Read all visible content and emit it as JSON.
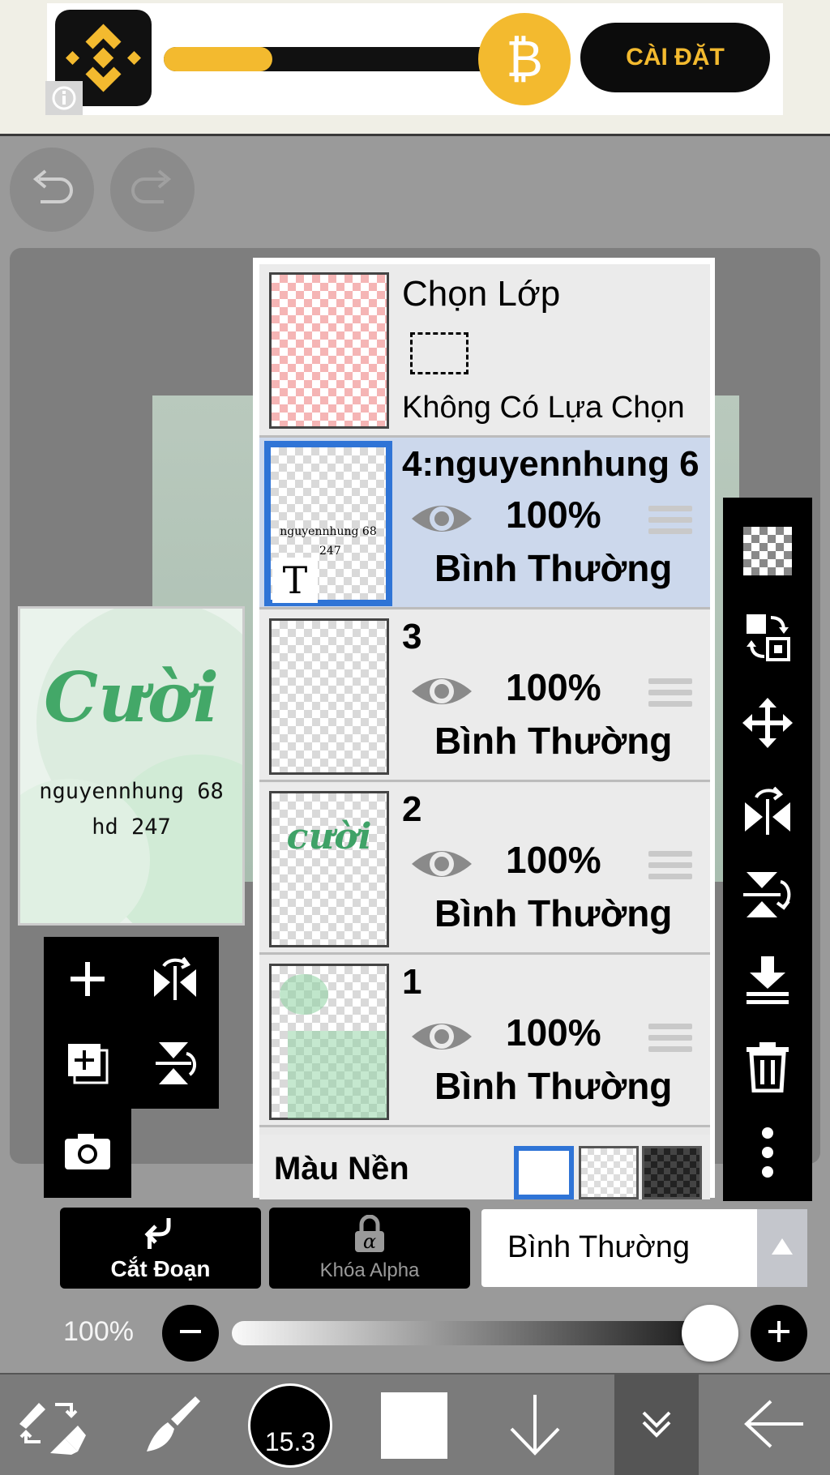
{
  "ad": {
    "cta_label": "CÀI ĐẶT",
    "progress": 0.32,
    "brand_color": "#f3ba2f"
  },
  "preview": {
    "title_art": "Cười",
    "line1": "nguyennhung 68",
    "line2": "hd 247"
  },
  "layers_panel": {
    "selection": {
      "title": "Chọn Lớp",
      "status": "Không Có Lựa Chọn"
    },
    "layers": [
      {
        "name": "4:nguyennhung 6",
        "opacity": "100%",
        "blend": "Bình Thường",
        "active": true,
        "thumb_text1": "nguyennhung 68",
        "thumb_text2": "247",
        "thumb_badge": "T"
      },
      {
        "name": "3",
        "opacity": "100%",
        "blend": "Bình Thường",
        "active": false
      },
      {
        "name": "2",
        "opacity": "100%",
        "blend": "Bình Thường",
        "active": false,
        "thumb_art": "cười"
      },
      {
        "name": "1",
        "opacity": "100%",
        "blend": "Bình Thường",
        "active": false
      }
    ],
    "background": {
      "label": "Màu Nền"
    }
  },
  "controls": {
    "clip_label": "Cắt Đoạn",
    "alpha_lock_label": "Khóa Alpha",
    "blend_mode": "Bình Thường",
    "opacity_label": "100%",
    "opacity_value": 1.0
  },
  "bottom_bar": {
    "brush_size": "15.3",
    "current_color": "#ffffff"
  },
  "colors": {
    "accent": "#2f74d6",
    "active_layer_bg": "#ccd8ec"
  }
}
